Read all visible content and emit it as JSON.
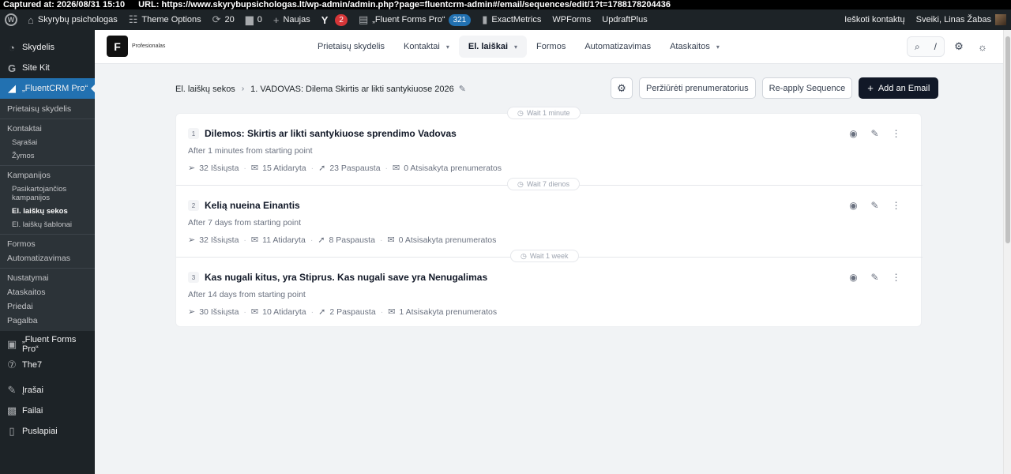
{
  "capture": {
    "captured": "Captured at: 2026/08/31 15:10",
    "url": "URL: https://www.skyrybupsichologas.lt/wp-admin/admin.php?page=fluentcrm-admin#/email/sequences/edit/1?t=1788178204436"
  },
  "adminbar": {
    "site": "Skyrybų psichologas",
    "theme_options": "Theme Options",
    "updates": "20",
    "comments": "0",
    "new": "Naujas",
    "yoast_badge": "2",
    "fluent_forms": "„Fluent Forms Pro“",
    "fluent_badge": "321",
    "exactmetrics": "ExactMetrics",
    "wpforms": "WPForms",
    "updraft": "UpdraftPlus",
    "search_contact": "Ieškoti kontaktų",
    "greeting": "Sveiki, Linas Žabas"
  },
  "sidebar": {
    "dashboard": "Skydelis",
    "sitekit": "Site Kit",
    "fluentcrm": "„FluentCRM Pro“",
    "sub": {
      "dashboard": "Prietaisų skydelis",
      "contacts": "Kontaktai",
      "lists": "Sąrašai",
      "tags": "Žymos",
      "campaigns": "Kampanijos",
      "recurring": "Pasikartojančios kampanijos",
      "sequences": "El. laiškų sekos",
      "templates": "El. laiškų šablonai",
      "forms": "Formos",
      "automations": "Automatizavimas",
      "settings": "Nustatymai",
      "reports": "Ataskaitos",
      "addons": "Priedai",
      "help": "Pagalba"
    },
    "fluentforms": "„Fluent Forms Pro“",
    "the7": "The7",
    "posts": "Įrašai",
    "media": "Failai",
    "pages": "Puslapiai"
  },
  "crm": {
    "logo_text": "Profesionalas",
    "nav": {
      "dashboard": "Prietaisų skydelis",
      "contacts": "Kontaktai",
      "emails": "El. laiškai",
      "forms": "Formos",
      "automations": "Automatizavimas",
      "reports": "Ataskaitos"
    },
    "search_shortcut": "/"
  },
  "breadcrumb": {
    "parent": "El. laiškų sekos",
    "current": "1. VADOVAS: Dilema Skirtis ar likti santykiuose 2026"
  },
  "actions": {
    "view_subscribers": "Peržiūrėti prenumeratorius",
    "reapply": "Re-apply Sequence",
    "add_email": "Add an Email"
  },
  "emails": [
    {
      "wait": "Wait 1 minute",
      "num": "1",
      "title": "Dilemos: Skirtis ar likti santykiuose sprendimo Vadovas",
      "subtitle": "After 1 minutes from starting point",
      "sent": "32 Išsiųsta",
      "opened": "15 Atidaryta",
      "clicked": "23 Paspausta",
      "unsub": "0 Atsisakyta prenumeratos"
    },
    {
      "wait": "Wait 7 dienos",
      "num": "2",
      "title": "Kelią nueina Einantis",
      "subtitle": "After 7 days from starting point",
      "sent": "32 Išsiųsta",
      "opened": "11 Atidaryta",
      "clicked": "8 Paspausta",
      "unsub": "0 Atsisakyta prenumeratos"
    },
    {
      "wait": "Wait 1 week",
      "num": "3",
      "title": "Kas nugali kitus, yra Stiprus. Kas nugali save yra Nenugalimas",
      "subtitle": "After 14 days from starting point",
      "sent": "30 Išsiųsta",
      "opened": "10 Atidaryta",
      "clicked": "2 Paspausta",
      "unsub": "1 Atsisakyta prenumeratos"
    }
  ]
}
